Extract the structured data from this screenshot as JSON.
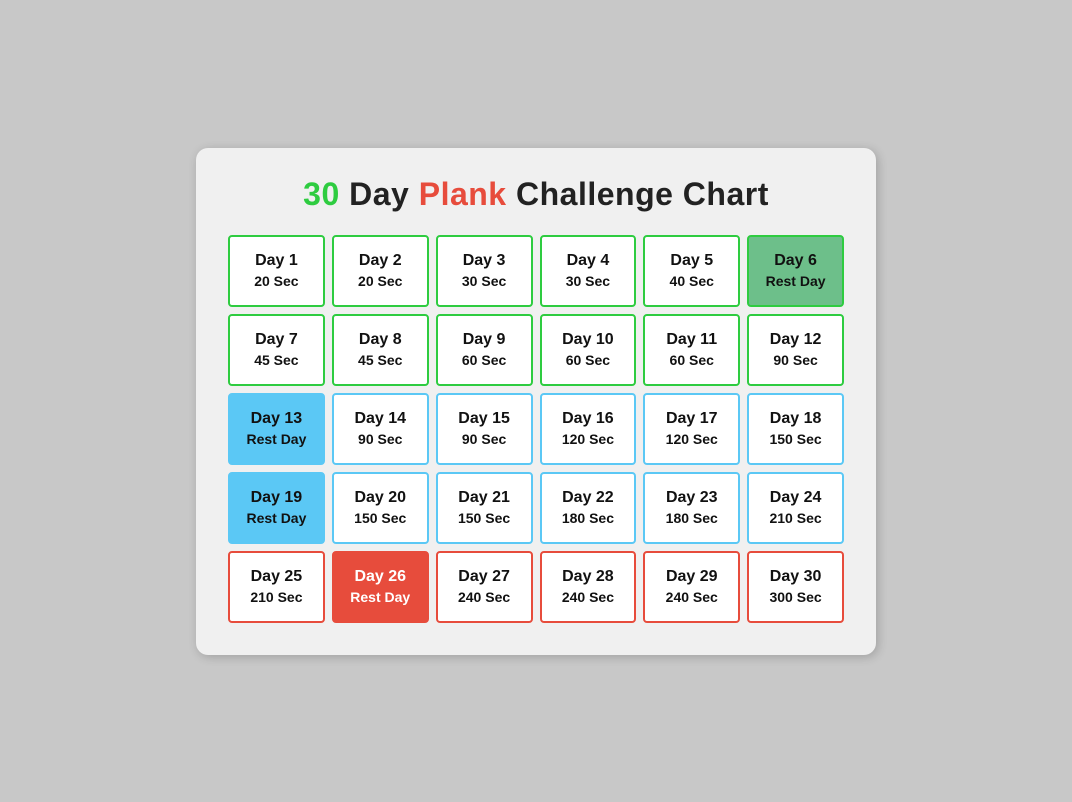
{
  "title": {
    "part1": "30",
    "part2": " Day ",
    "part3": "Plank",
    "part4": " Challenge Chart"
  },
  "grid": [
    [
      {
        "day": "Day 1",
        "time": "20 Sec",
        "style": "green-border"
      },
      {
        "day": "Day 2",
        "time": "20 Sec",
        "style": "green-border"
      },
      {
        "day": "Day 3",
        "time": "30 Sec",
        "style": "green-border"
      },
      {
        "day": "Day 4",
        "time": "30 Sec",
        "style": "green-border"
      },
      {
        "day": "Day 5",
        "time": "40 Sec",
        "style": "green-border"
      },
      {
        "day": "Day 6",
        "time": "Rest Day",
        "style": "green-fill"
      }
    ],
    [
      {
        "day": "Day 7",
        "time": "45 Sec",
        "style": "green-border"
      },
      {
        "day": "Day 8",
        "time": "45 Sec",
        "style": "green-border"
      },
      {
        "day": "Day 9",
        "time": "60 Sec",
        "style": "green-border"
      },
      {
        "day": "Day 10",
        "time": "60 Sec",
        "style": "green-border"
      },
      {
        "day": "Day 11",
        "time": "60 Sec",
        "style": "green-border"
      },
      {
        "day": "Day 12",
        "time": "90 Sec",
        "style": "green-border"
      }
    ],
    [
      {
        "day": "Day 13",
        "time": "Rest Day",
        "style": "blue-fill"
      },
      {
        "day": "Day 14",
        "time": "90 Sec",
        "style": "blue-border"
      },
      {
        "day": "Day 15",
        "time": "90 Sec",
        "style": "blue-border"
      },
      {
        "day": "Day 16",
        "time": "120 Sec",
        "style": "blue-border"
      },
      {
        "day": "Day 17",
        "time": "120 Sec",
        "style": "blue-border"
      },
      {
        "day": "Day 18",
        "time": "150 Sec",
        "style": "blue-border"
      }
    ],
    [
      {
        "day": "Day 19",
        "time": "Rest Day",
        "style": "blue-fill2"
      },
      {
        "day": "Day 20",
        "time": "150 Sec",
        "style": "blue-border2"
      },
      {
        "day": "Day 21",
        "time": "150 Sec",
        "style": "blue-border2"
      },
      {
        "day": "Day 22",
        "time": "180 Sec",
        "style": "blue-border2"
      },
      {
        "day": "Day 23",
        "time": "180 Sec",
        "style": "blue-border2"
      },
      {
        "day": "Day 24",
        "time": "210 Sec",
        "style": "blue-border2"
      }
    ],
    [
      {
        "day": "Day 25",
        "time": "210 Sec",
        "style": "red-border"
      },
      {
        "day": "Day 26",
        "time": "Rest Day",
        "style": "red-fill"
      },
      {
        "day": "Day 27",
        "time": "240 Sec",
        "style": "red-border"
      },
      {
        "day": "Day 28",
        "time": "240 Sec",
        "style": "red-border"
      },
      {
        "day": "Day 29",
        "time": "240 Sec",
        "style": "red-border"
      },
      {
        "day": "Day 30",
        "time": "300 Sec",
        "style": "red-border"
      }
    ]
  ]
}
